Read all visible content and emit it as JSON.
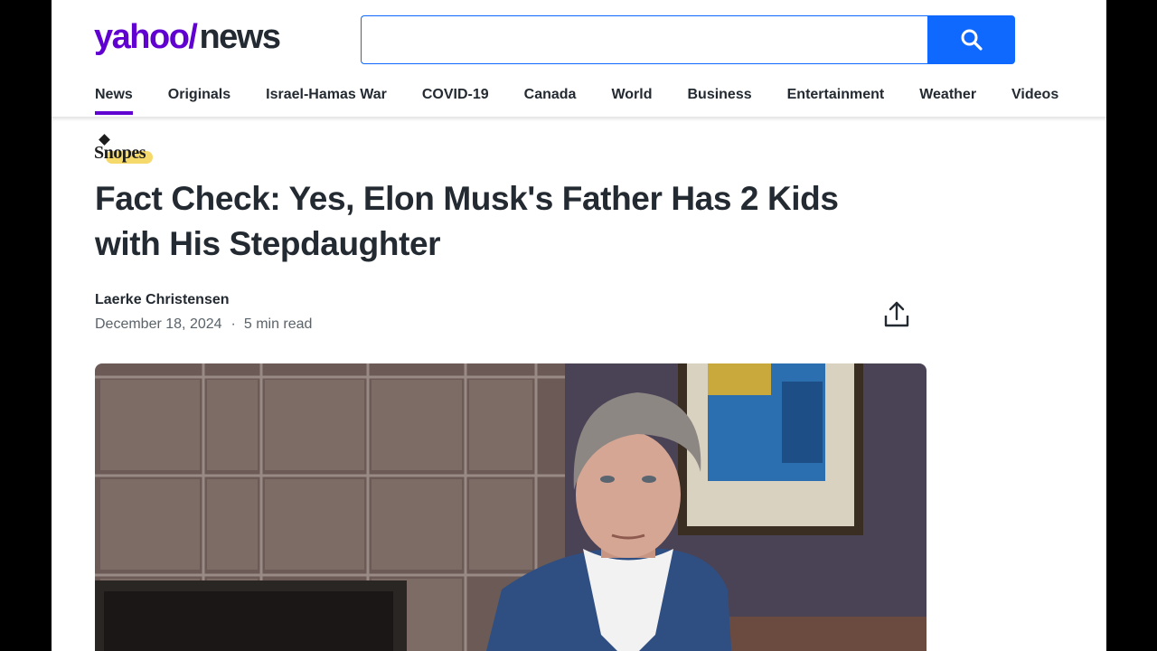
{
  "header": {
    "logo_yahoo": "yahoo/",
    "logo_news": "news",
    "search": {
      "value": "",
      "placeholder": ""
    }
  },
  "nav": {
    "items": [
      {
        "label": "News",
        "active": true
      },
      {
        "label": "Originals"
      },
      {
        "label": "Israel-Hamas War"
      },
      {
        "label": "COVID-19"
      },
      {
        "label": "Canada"
      },
      {
        "label": "World"
      },
      {
        "label": "Business"
      },
      {
        "label": "Entertainment"
      },
      {
        "label": "Weather"
      },
      {
        "label": "Videos"
      }
    ]
  },
  "article": {
    "source": "Snopes",
    "title_line1": "Fact Check: Yes, Elon Musk's Father Has 2 Kids",
    "title_line2": "with His Stepdaughter",
    "author": "Laerke Christensen",
    "date": "December 18, 2024",
    "separator": "·",
    "read_time": "5 min read"
  },
  "icons": {
    "search": "search-icon",
    "share": "share-icon"
  },
  "colors": {
    "brand_purple": "#6001d2",
    "search_blue": "#0f69ff",
    "text_dark": "#232a31",
    "text_meta": "#5b636a"
  }
}
